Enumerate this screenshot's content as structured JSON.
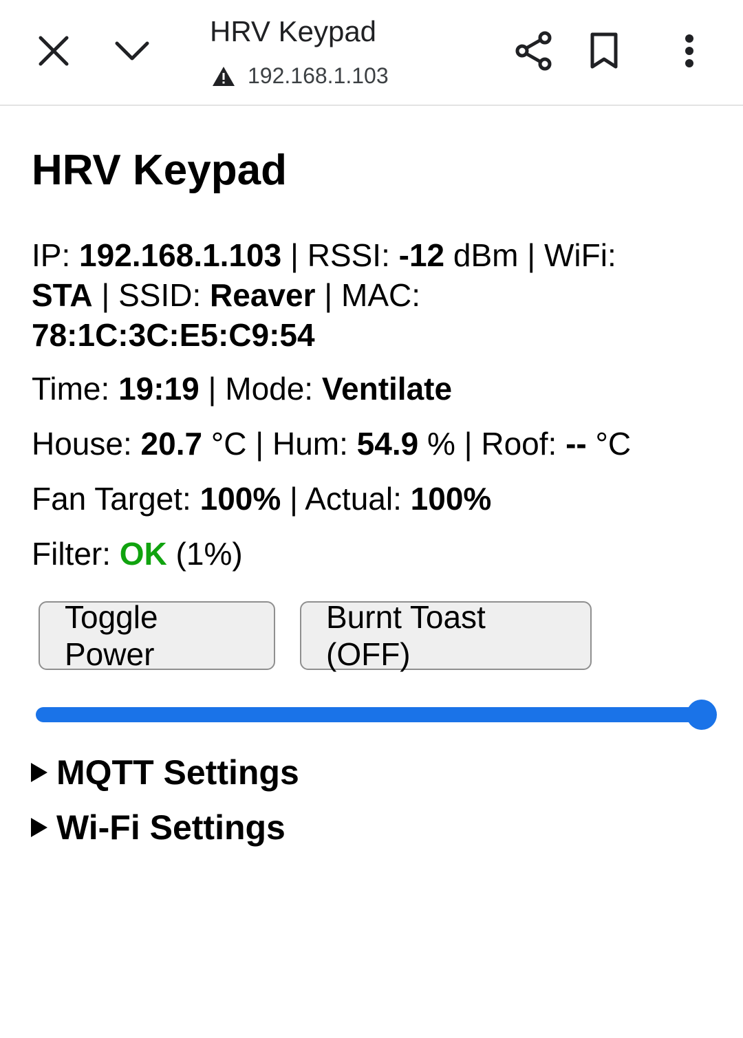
{
  "browser": {
    "title": "HRV Keypad",
    "url": "192.168.1.103",
    "icons": [
      "close-icon",
      "chevron-down-icon",
      "warning-icon",
      "share-icon",
      "bookmark-icon",
      "more-vert-icon"
    ]
  },
  "page": {
    "heading": "HRV Keypad",
    "network": {
      "ip_label": "IP: ",
      "ip_value": "192.168.1.103",
      "rssi_label": " | RSSI: ",
      "rssi_value": "-12",
      "rssi_unit": " dBm | WiFi: ",
      "wifi_value": "STA",
      "ssid_label": " | SSID: ",
      "ssid_value": "Reaver",
      "mac_label": " | MAC: ",
      "mac_value": "78:1C:3C:E5:C9:54"
    },
    "time": {
      "time_label": "Time: ",
      "time_value": "19:19",
      "mode_label": " | Mode: ",
      "mode_value": "Ventilate"
    },
    "environment": {
      "house_label": "House: ",
      "house_value": "20.7",
      "house_unit": " °C | Hum: ",
      "hum_value": "54.9",
      "hum_unit": " % | Roof: ",
      "roof_value": "--",
      "roof_unit": " °C"
    },
    "fan": {
      "target_label": "Fan Target: ",
      "target_value": "100%",
      "actual_label": " | Actual: ",
      "actual_value": "100%"
    },
    "filter": {
      "label": "Filter: ",
      "status": "OK",
      "percent": " (1%)"
    },
    "buttons": {
      "toggle_power": "Toggle Power",
      "burnt_toast": "Burnt Toast (OFF)"
    },
    "fan_slider": {
      "value": 100,
      "min": 0,
      "max": 100
    },
    "sections": {
      "mqtt": "MQTT Settings",
      "wifi": "Wi-Fi Settings"
    }
  },
  "colors": {
    "accent": "#1a73e8",
    "ok": "#10a30f",
    "button_bg": "#efefef",
    "button_border": "#8f8f8f"
  }
}
